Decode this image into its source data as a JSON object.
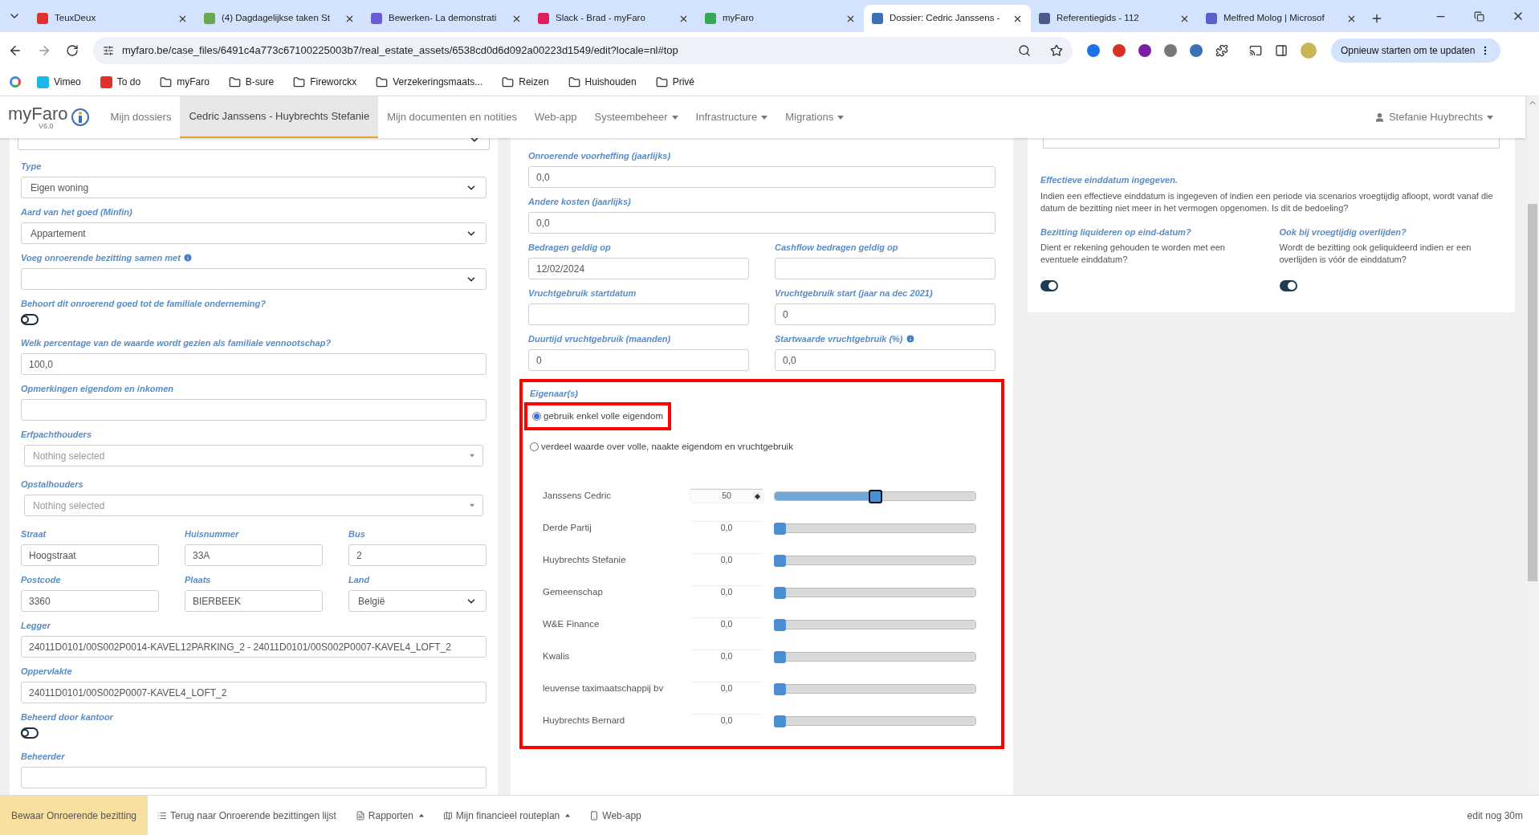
{
  "browser": {
    "tabs": [
      {
        "title": "TeuxDeux",
        "selected": false
      },
      {
        "title": "(4) Dagdagelijkse taken St",
        "selected": false
      },
      {
        "title": "Bewerken- La demonstrati",
        "selected": false
      },
      {
        "title": "Slack - Brad - myFaro",
        "selected": false
      },
      {
        "title": "myFaro",
        "selected": false
      },
      {
        "title": "Dossier: Cedric Janssens -",
        "selected": true
      },
      {
        "title": "Referentiegids - 112",
        "selected": false
      },
      {
        "title": "Melfred Molog | Microsof",
        "selected": false
      }
    ],
    "url": "myfaro.be/case_files/6491c4a773c67100225003b7/real_estate_assets/6538cd0d6d092a00223d1549/edit?locale=nl#top",
    "update_button": "Opnieuw starten om te updaten",
    "bookmarks": [
      {
        "kind": "google"
      },
      {
        "kind": "site",
        "label": "Vimeo"
      },
      {
        "kind": "site",
        "label": "To do"
      },
      {
        "kind": "folder",
        "label": "myFaro"
      },
      {
        "kind": "folder",
        "label": "B-sure"
      },
      {
        "kind": "folder",
        "label": "Fireworckx"
      },
      {
        "kind": "folder",
        "label": "Verzekeringsmaats..."
      },
      {
        "kind": "folder",
        "label": "Reizen"
      },
      {
        "kind": "folder",
        "label": "Huishouden"
      },
      {
        "kind": "folder",
        "label": "Privé"
      }
    ]
  },
  "navbar": {
    "logo": "myFaro",
    "version": "V6.0",
    "items": [
      {
        "label": "Mijn dossiers",
        "selected": false,
        "dropdown": false
      },
      {
        "label": "Cedric Janssens - Huybrechts Stefanie",
        "selected": true,
        "dropdown": false
      },
      {
        "label": "Mijn documenten en notities",
        "selected": false,
        "dropdown": false
      },
      {
        "label": "Web-app",
        "selected": false,
        "dropdown": false
      },
      {
        "label": "Systeembeheer",
        "selected": false,
        "dropdown": true
      },
      {
        "label": "Infrastructure",
        "selected": false,
        "dropdown": true
      },
      {
        "label": "Migrations",
        "selected": false,
        "dropdown": true
      }
    ],
    "user": "Stefanie Huybrechts"
  },
  "left_form": {
    "fields": [
      {
        "kind": "cut_select"
      },
      {
        "kind": "select",
        "label": "Type",
        "value": "Eigen woning"
      },
      {
        "kind": "select",
        "label": "Aard van het goed (Minfin)",
        "value": "Appartement"
      },
      {
        "kind": "select",
        "label": "Voeg onroerende bezitting samen met",
        "info": true
      },
      {
        "kind": "toggle",
        "label": "Behoort dit onroerend goed tot de familiale onderneming?",
        "on": false
      },
      {
        "kind": "input",
        "label": "Welk percentage van de waarde wordt gezien als familiale vennootschap?",
        "value": "100,0"
      },
      {
        "kind": "input",
        "label": "Opmerkingen eigendom en inkomen"
      },
      {
        "kind": "multiselect",
        "label": "Erfpachthouders",
        "placeholder": "Nothing selected"
      },
      {
        "kind": "multiselect",
        "label": "Opstalhouders",
        "placeholder": "Nothing selected"
      },
      {
        "kind": "row",
        "fields": [
          {
            "kind": "input",
            "label": "Straat",
            "value": "Hoogstraat"
          },
          {
            "kind": "input",
            "label": "Huisnummer",
            "value": "33A"
          },
          {
            "kind": "input",
            "label": "Bus",
            "value": "2"
          }
        ]
      },
      {
        "kind": "row",
        "fields": [
          {
            "kind": "input",
            "label": "Postcode",
            "value": "3360"
          },
          {
            "kind": "input",
            "label": "Plaats",
            "value": "BIERBEEK"
          },
          {
            "kind": "select",
            "label": "Land",
            "value": "België"
          }
        ]
      },
      {
        "kind": "input",
        "label": "Legger",
        "value": "24011D0101/00S002P0014-KAVEL12PARKING_2 - 24011D0101/00S002P0007-KAVEL4_LOFT_2"
      },
      {
        "kind": "input",
        "label": "Oppervlakte",
        "value": "24011D0101/00S002P0007-KAVEL4_LOFT_2"
      },
      {
        "kind": "toggle",
        "label": "Beheerd door kantoor",
        "on": false
      },
      {
        "kind": "input",
        "label": "Beheerder"
      }
    ]
  },
  "middle_form": {
    "fields": [
      {
        "kind": "input",
        "label": "Onroerende voorheffing (jaarlijks)",
        "value": "0,0"
      },
      {
        "kind": "input",
        "label": "Andere kosten (jaarlijks)",
        "value": "0,0"
      },
      {
        "kind": "row",
        "fields": [
          {
            "kind": "input",
            "label": "Bedragen geldig op",
            "value": "12/02/2024"
          },
          {
            "kind": "input",
            "label": "Cashflow bedragen geldig op"
          }
        ]
      },
      {
        "kind": "row",
        "fields": [
          {
            "kind": "input",
            "label": "Vruchtgebruik startdatum"
          },
          {
            "kind": "input",
            "label": "Vruchtgebruik start (jaar na dec 2021)",
            "value": "0"
          }
        ]
      },
      {
        "kind": "row",
        "fields": [
          {
            "kind": "input",
            "label": "Duurtijd vruchtgebruik (maanden)",
            "value": "0"
          },
          {
            "kind": "input",
            "label": "Startwaarde vruchtgebruik (%)",
            "info": true,
            "value": "0,0"
          }
        ]
      }
    ],
    "owners": {
      "label": "Eigenaar(s)",
      "options": [
        {
          "label": "gebruik enkel volle eigendom",
          "selected": true
        },
        {
          "label": "verdeel waarde over volle, naakte eigendom en vruchtgebruik",
          "selected": false
        }
      ],
      "rows": [
        {
          "name": "Janssens Cedric",
          "value": "50",
          "focused": true,
          "level": 0.5
        },
        {
          "name": "Derde Partij",
          "value": "0,0",
          "focused": false,
          "level": 0
        },
        {
          "name": "Huybrechts Stefanie",
          "value": "0,0",
          "focused": false,
          "level": 0
        },
        {
          "name": "Gemeenschap",
          "value": "0,0",
          "focused": false,
          "level": 0
        },
        {
          "name": "W&E Finance",
          "value": "0,0",
          "focused": false,
          "level": 0
        },
        {
          "name": "Kwalis",
          "value": "0,0",
          "focused": false,
          "level": 0
        },
        {
          "name": "leuvense taximaatschappij bv",
          "value": "0,0",
          "focused": false,
          "level": 0
        },
        {
          "name": "Huybrechts Bernard",
          "value": "0,0",
          "focused": false,
          "level": 0
        }
      ]
    }
  },
  "right_panel": {
    "notice_title": "Effectieve einddatum ingegeven.",
    "notice_text": "Indien een effectieve einddatum is ingegeven of indien een periode via scenarios vroegtijdig afloopt, wordt vanaf die datum de bezitting niet meer in het vermogen opgenomen. Is dit de bedoeling?",
    "questions": [
      {
        "title": "Bezitting liquideren op eind-datum?",
        "text": "Dient er rekening gehouden te worden met een eventuele einddatum?",
        "on": true
      },
      {
        "title": "Ook bij vroegtijdig overlijden?",
        "text": "Wordt de bezitting ook geliquideerd indien er een overlijden is vóór de einddatum?",
        "on": true
      }
    ]
  },
  "bottom_bar": {
    "save_button": "Bewaar Onroerende bezitting",
    "links": [
      {
        "label": "Terug naar Onroerende bezittingen lijst",
        "dropdown": false
      },
      {
        "label": "Rapporten",
        "dropdown": true
      },
      {
        "label": "Mijn financieel routeplan",
        "dropdown": true
      },
      {
        "label": "Web-app",
        "dropdown": false
      }
    ],
    "session": "edit nog 30m"
  }
}
